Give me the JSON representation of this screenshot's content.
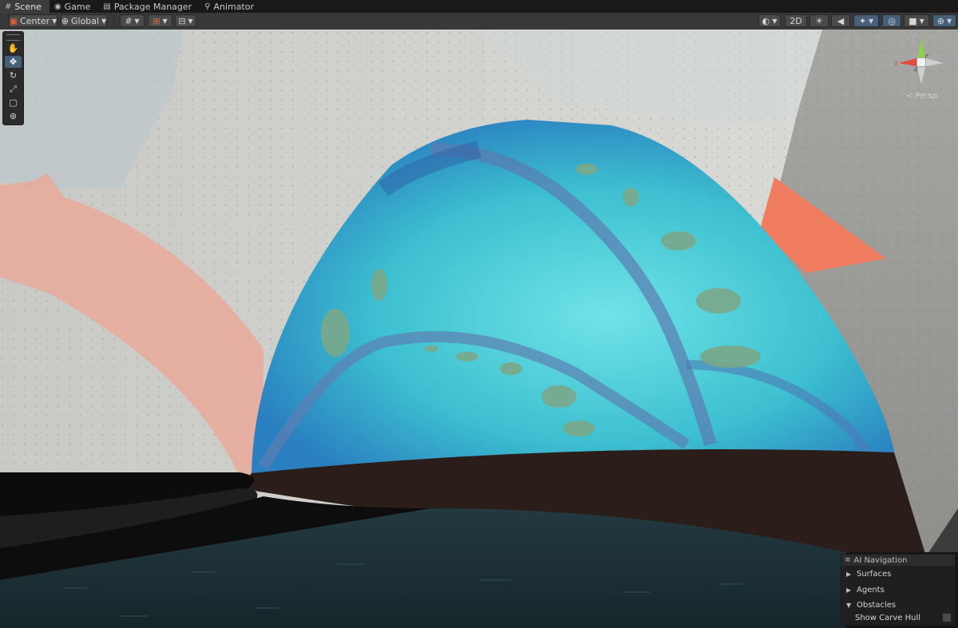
{
  "tabs": [
    {
      "label": "Scene",
      "icon": "scene-grid-icon",
      "active": true
    },
    {
      "label": "Game",
      "icon": "gamepad-icon",
      "active": false
    },
    {
      "label": "Package Manager",
      "icon": "package-icon",
      "active": false
    },
    {
      "label": "Animator",
      "icon": "animator-icon",
      "active": false
    }
  ],
  "toolbar": {
    "pivot_label": "Center",
    "space_label": "Global",
    "mode_2d_label": "2D"
  },
  "tools": [
    {
      "name": "hand-tool",
      "icon": "hand-icon"
    },
    {
      "name": "move-tool",
      "icon": "move-arrows-icon",
      "selected": true
    },
    {
      "name": "rotate-tool",
      "icon": "rotate-icon"
    },
    {
      "name": "scale-tool",
      "icon": "scale-icon"
    },
    {
      "name": "rect-tool",
      "icon": "rect-icon"
    },
    {
      "name": "transform-tool",
      "icon": "transform-icon"
    }
  ],
  "gizmo": {
    "x_label": "x",
    "y_label": "y",
    "projection_label": "< Persp"
  },
  "nav_panel": {
    "title": "AI Navigation",
    "items": [
      {
        "label": "Surfaces",
        "expanded": false
      },
      {
        "label": "Agents",
        "expanded": false
      },
      {
        "label": "Obstacles",
        "expanded": true
      }
    ],
    "show_carve_hull_label": "Show Carve Hull"
  },
  "colors": {
    "accent": "#46607c",
    "dome": "#3fbfcf",
    "floor": "#1f3238",
    "gizmo_x": "#e24c3a",
    "gizmo_y": "#8fd14f"
  }
}
